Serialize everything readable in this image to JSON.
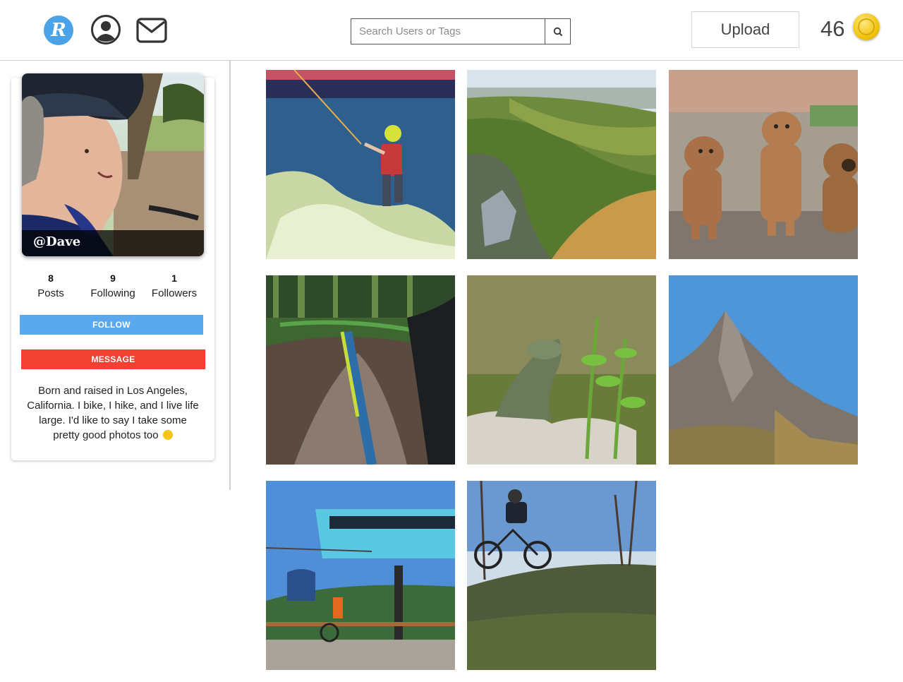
{
  "header": {
    "logo_letter": "R",
    "search_placeholder": "Search Users or Tags",
    "upload_label": "Upload",
    "coin_count": "46"
  },
  "profile": {
    "username": "@Dave",
    "stats": [
      {
        "value": "8",
        "label": "Posts"
      },
      {
        "value": "9",
        "label": "Following"
      },
      {
        "value": "1",
        "label": "Followers"
      }
    ],
    "follow_label": "FOLLOW",
    "message_label": "MESSAGE",
    "bio": "Born and raised in Los Angeles, California. I bike, I hike, and I live life large. I'd like to say I take some pretty good photos too"
  },
  "colors": {
    "brand": "#4aa3e8",
    "follow": "#5aa8ee",
    "message": "#f24133",
    "coin": "#f1c40f"
  },
  "photos": [
    {
      "subject": "wakeboarding"
    },
    {
      "subject": "green valley"
    },
    {
      "subject": "three puppies"
    },
    {
      "subject": "mountain bike trail"
    },
    {
      "subject": "iguana"
    },
    {
      "subject": "rocky peak"
    },
    {
      "subject": "gondola lift"
    },
    {
      "subject": "bike jump"
    }
  ]
}
